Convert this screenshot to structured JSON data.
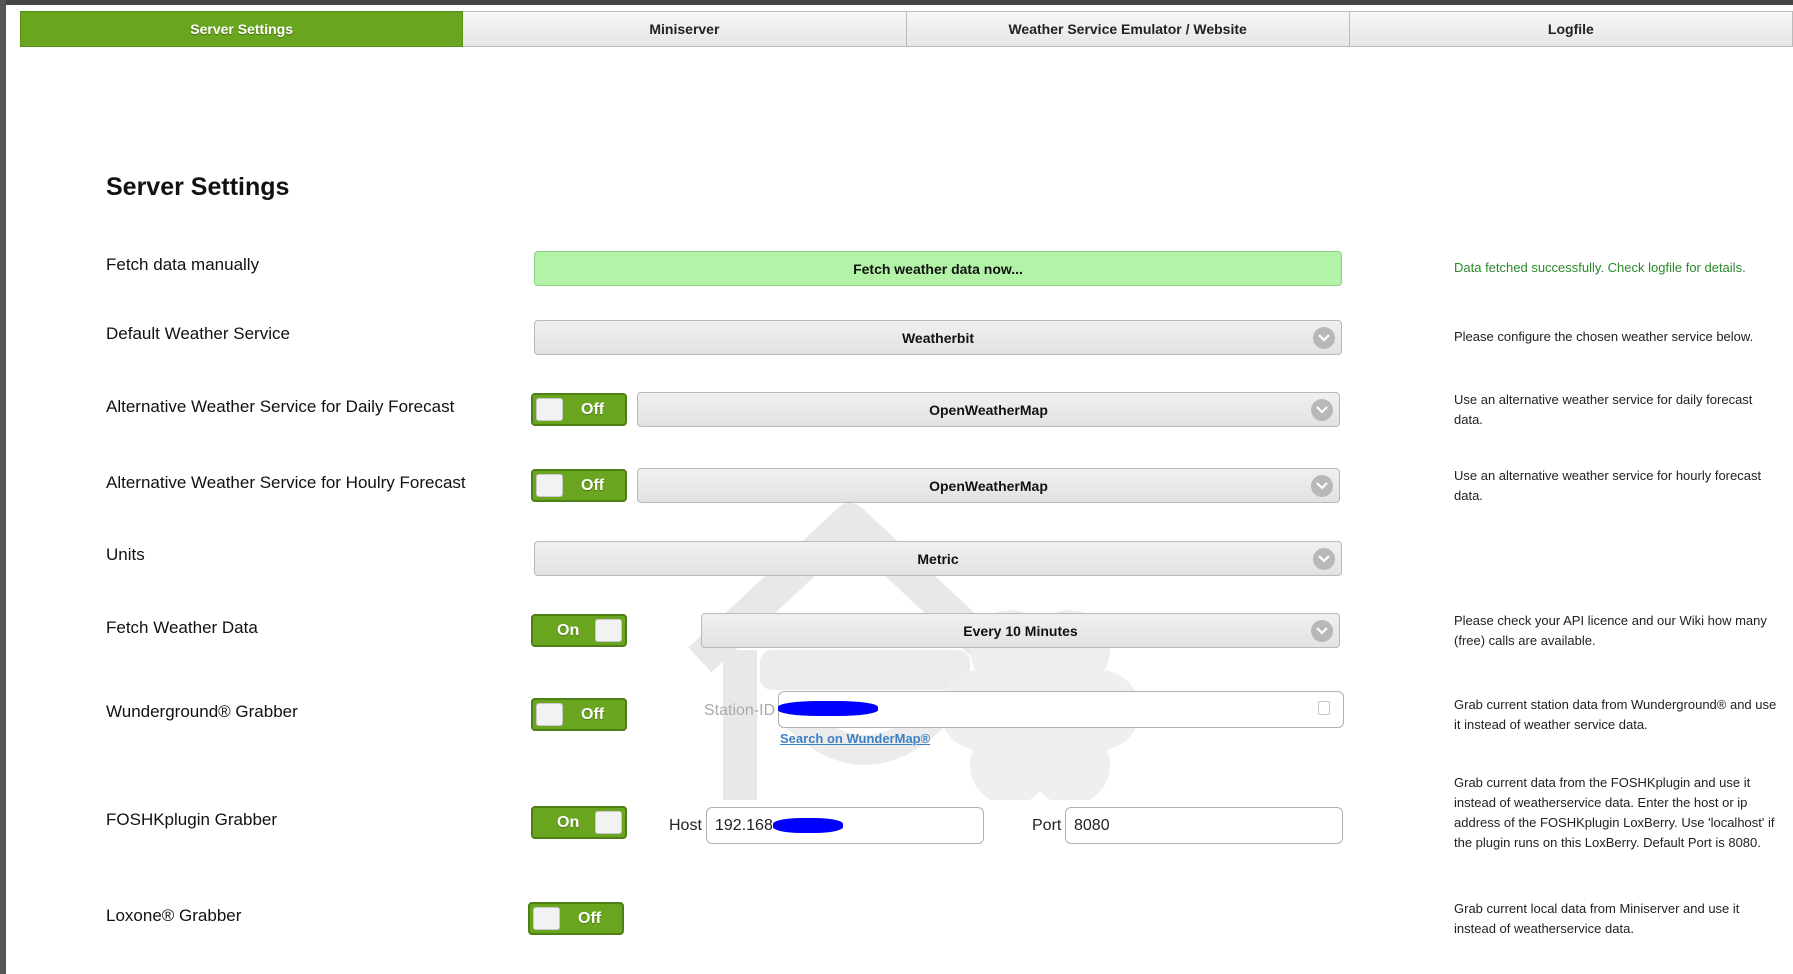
{
  "tabs": [
    {
      "label": "Server Settings",
      "active": true
    },
    {
      "label": "Miniserver",
      "active": false
    },
    {
      "label": "Weather Service Emulator / Website",
      "active": false
    },
    {
      "label": "Logfile",
      "active": false
    }
  ],
  "page": {
    "title": "Server Settings"
  },
  "rows": {
    "fetch_manual": {
      "label": "Fetch data manually",
      "button_label": "Fetch weather data now...",
      "hint": "Data fetched successfully. Check logfile for details."
    },
    "default_service": {
      "label": "Default Weather Service",
      "select_value": "Weatherbit",
      "hint": "Please configure the chosen weather service below."
    },
    "alt_daily": {
      "label": "Alternative Weather Service for Daily Forecast",
      "toggle_label": "Off",
      "select_value": "OpenWeatherMap",
      "hint": "Use an alternative weather service for daily forecast data."
    },
    "alt_hourly": {
      "label": "Alternative Weather Service for Houlry Forecast",
      "toggle_label": "Off",
      "select_value": "OpenWeatherMap",
      "hint": "Use an alternative weather service for hourly forecast data."
    },
    "units": {
      "label": "Units",
      "select_value": "Metric"
    },
    "fetch_data": {
      "label": "Fetch Weather Data",
      "toggle_label": "On",
      "select_value": "Every 10 Minutes",
      "hint": "Please check your API licence and our Wiki how many (free) calls are available."
    },
    "wunderground": {
      "label": "Wunderground® Grabber",
      "toggle_label": "Off",
      "station_label": "Station-ID",
      "station_value": "",
      "link_label": "Search on WunderMap®",
      "hint": "Grab current station data from Wunderground® and use it instead of weather service data."
    },
    "foshk": {
      "label": "FOSHKplugin Grabber",
      "toggle_label": "On",
      "host_label": "Host",
      "host_value": "192.168",
      "port_label": "Port",
      "port_value": "8080",
      "hint": "Grab current data from the FOSHKplugin and use it instead of weatherservice data. Enter the host or ip address of the FOSHKplugin LoxBerry. Use 'localhost' if the plugin runs on this LoxBerry. Default Port is 8080."
    },
    "loxone": {
      "label": "Loxone® Grabber",
      "toggle_label": "Off",
      "hint": "Grab current local data from Miniserver and use it instead of weatherservice data."
    }
  },
  "colors": {
    "accent_green": "#6aa520",
    "fetch_button_bg": "#b3f3a8",
    "success_text": "#2a8a2a",
    "link": "#3d7fc2",
    "redaction": "#0000ff"
  }
}
